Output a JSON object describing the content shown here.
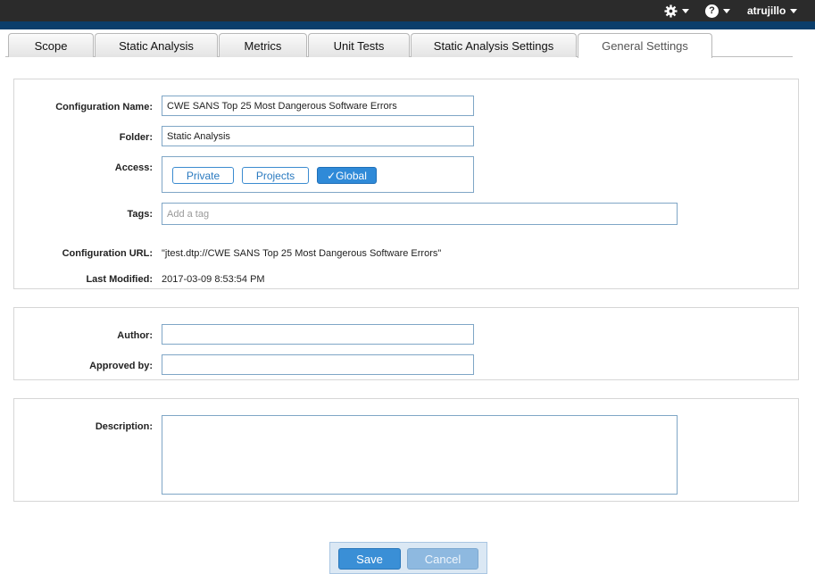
{
  "topbar": {
    "settings_icon": "gear-icon",
    "help_icon": "help-icon",
    "help_glyph": "?",
    "username": "atrujillo"
  },
  "tabs": [
    {
      "label": "Scope",
      "active": false
    },
    {
      "label": "Static Analysis",
      "active": false
    },
    {
      "label": "Metrics",
      "active": false
    },
    {
      "label": "Unit Tests",
      "active": false
    },
    {
      "label": "Static Analysis Settings",
      "active": false
    },
    {
      "label": "General Settings",
      "active": true
    }
  ],
  "general": {
    "config_name_label": "Configuration Name:",
    "config_name_value": "CWE SANS Top 25 Most Dangerous Software Errors",
    "folder_label": "Folder:",
    "folder_value": "Static Analysis",
    "access_label": "Access:",
    "access_options": [
      "Private",
      "Projects",
      "✓Global"
    ],
    "access_selected": "Global",
    "tags_label": "Tags:",
    "tags_placeholder": "Add a tag",
    "config_url_label": "Configuration URL:",
    "config_url_value": "\"jtest.dtp://CWE SANS Top 25 Most Dangerous Software Errors\"",
    "last_modified_label": "Last Modified:",
    "last_modified_value": "2017-03-09 8:53:54 PM"
  },
  "people": {
    "author_label": "Author:",
    "author_value": "",
    "approved_label": "Approved by:",
    "approved_value": ""
  },
  "description": {
    "label": "Description:",
    "value": ""
  },
  "footer": {
    "save_label": "Save",
    "cancel_label": "Cancel"
  },
  "colors": {
    "topbar": "#2b2b2b",
    "stripe": "#0b3e6b",
    "accent": "#2f8ad8",
    "field_border": "#7fa6c6"
  }
}
